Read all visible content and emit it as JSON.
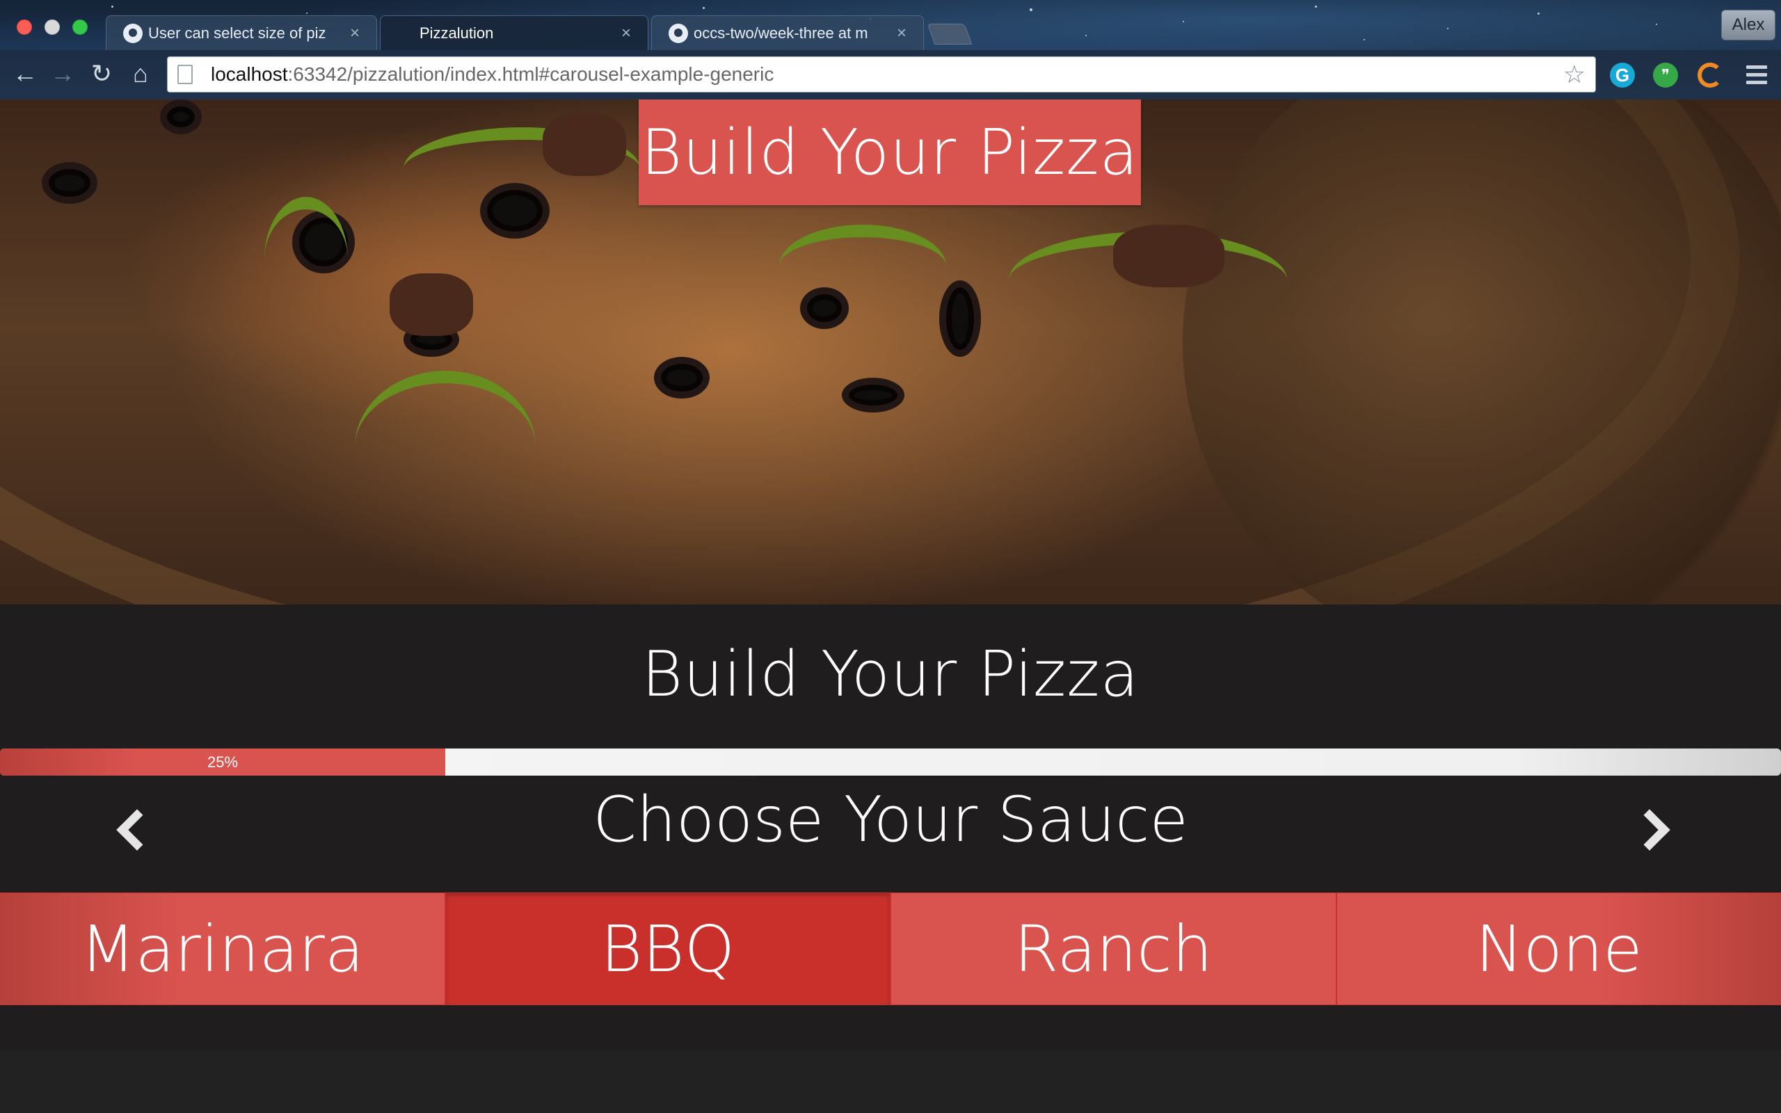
{
  "browser": {
    "tabs": [
      {
        "title": "User can select size of piz"
      },
      {
        "title": "Pizzalution"
      },
      {
        "title": "occs-two/week-three at m"
      }
    ],
    "profile_name": "Alex",
    "url_host": "localhost",
    "url_rest": ":63342/pizzalution/index.html#carousel-example-generic"
  },
  "hero": {
    "banner_title": "Build Your Pizza"
  },
  "builder": {
    "title": "Build Your Pizza",
    "progress_label": "25%",
    "progress_value": 0.25,
    "step_title": "Choose Your Sauce",
    "options": [
      {
        "label": "Marinara",
        "selected": false
      },
      {
        "label": "BBQ",
        "selected": true
      },
      {
        "label": "Ranch",
        "selected": false
      },
      {
        "label": "None",
        "selected": false
      }
    ]
  },
  "colors": {
    "accent": "#d9534f",
    "accent_active": "#c9302c",
    "background": "#1f1d1e"
  }
}
